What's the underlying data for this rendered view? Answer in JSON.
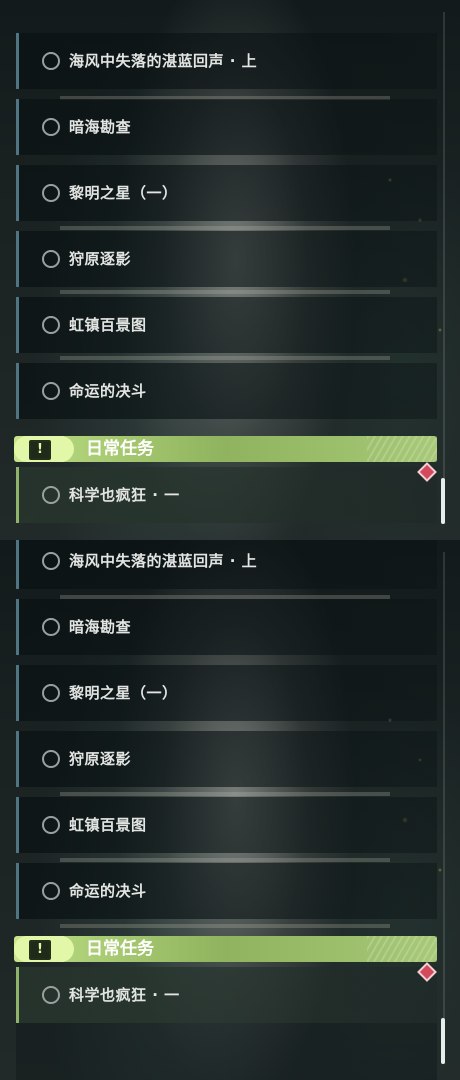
{
  "panels": [
    {
      "quests": [
        {
          "label": "海风中失落的湛蓝回声 · 上"
        },
        {
          "label": "暗海勘查"
        },
        {
          "label": "黎明之星（一）"
        },
        {
          "label": "狩原逐影"
        },
        {
          "label": "虹镇百景图"
        },
        {
          "label": "命运的决斗"
        }
      ],
      "category": {
        "title": "日常任务",
        "icon": "exclamation-icon"
      },
      "daily_quests": [
        {
          "label": "科学也疯狂 · 一"
        }
      ]
    },
    {
      "quests": [
        {
          "label": "海风中失落的湛蓝回声 · 上"
        },
        {
          "label": "暗海勘查"
        },
        {
          "label": "黎明之星（一）"
        },
        {
          "label": "狩原逐影"
        },
        {
          "label": "虹镇百景图"
        },
        {
          "label": "命运的决斗"
        }
      ],
      "category": {
        "title": "日常任务",
        "icon": "exclamation-icon"
      },
      "daily_quests": [
        {
          "label": "科学也疯狂 · 一"
        }
      ]
    }
  ],
  "colors": {
    "accent_green": "#b1d37a",
    "quest_border": "#4f7583",
    "marker": "#d24a5c"
  }
}
